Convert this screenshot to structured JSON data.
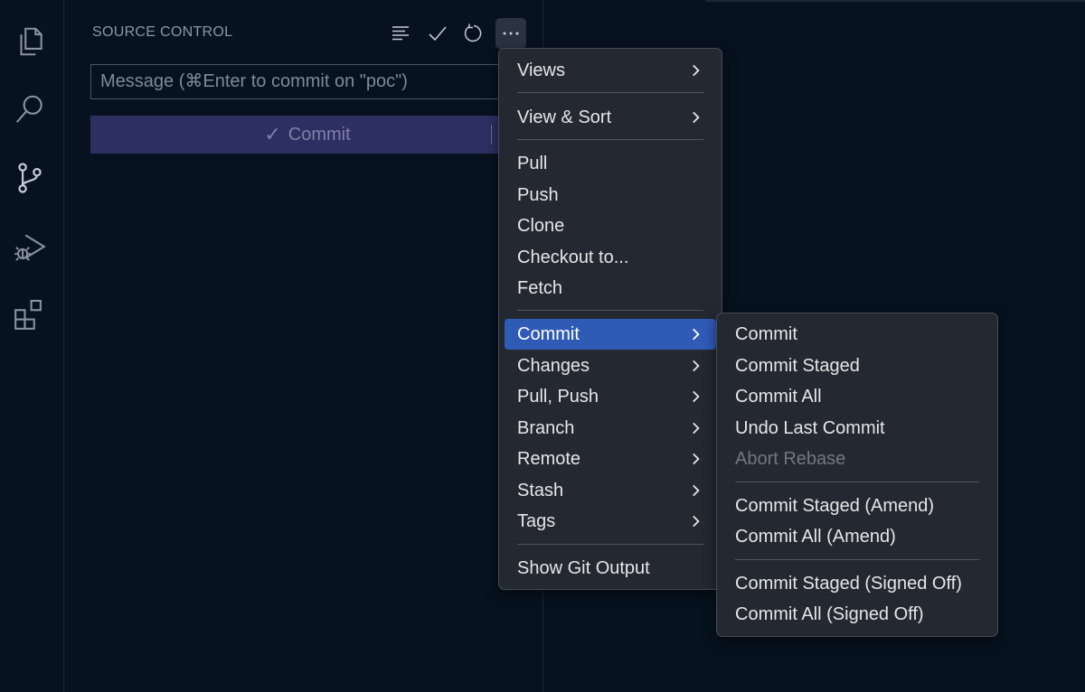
{
  "sidebar": {
    "title": "SOURCE CONTROL",
    "commit_message_placeholder": "Message (⌘Enter to commit on \"poc\")",
    "commit_button_label": "Commit"
  },
  "activity_bar": {
    "icons": [
      "explorer-icon",
      "search-icon",
      "source-control-icon",
      "run-debug-icon",
      "extensions-icon"
    ]
  },
  "header_actions": [
    "view-as-tree-icon",
    "commit-check-icon",
    "refresh-icon",
    "more-actions-icon"
  ],
  "main_menu": {
    "items": [
      "Views",
      "View & Sort",
      "Pull",
      "Push",
      "Clone",
      "Checkout to...",
      "Fetch",
      "Commit",
      "Changes",
      "Pull, Push",
      "Branch",
      "Remote",
      "Stash",
      "Tags",
      "Show Git Output"
    ]
  },
  "commit_submenu": {
    "items": [
      "Commit",
      "Commit Staged",
      "Commit All",
      "Undo Last Commit",
      "Abort Rebase",
      "Commit Staged (Amend)",
      "Commit All (Amend)",
      "Commit Staged (Signed Off)",
      "Commit All (Signed Off)"
    ]
  },
  "colors": {
    "background": "#06121f",
    "menu_background": "#242831",
    "menu_highlight": "#2f5bb7",
    "commit_button": "#2d2f63"
  }
}
